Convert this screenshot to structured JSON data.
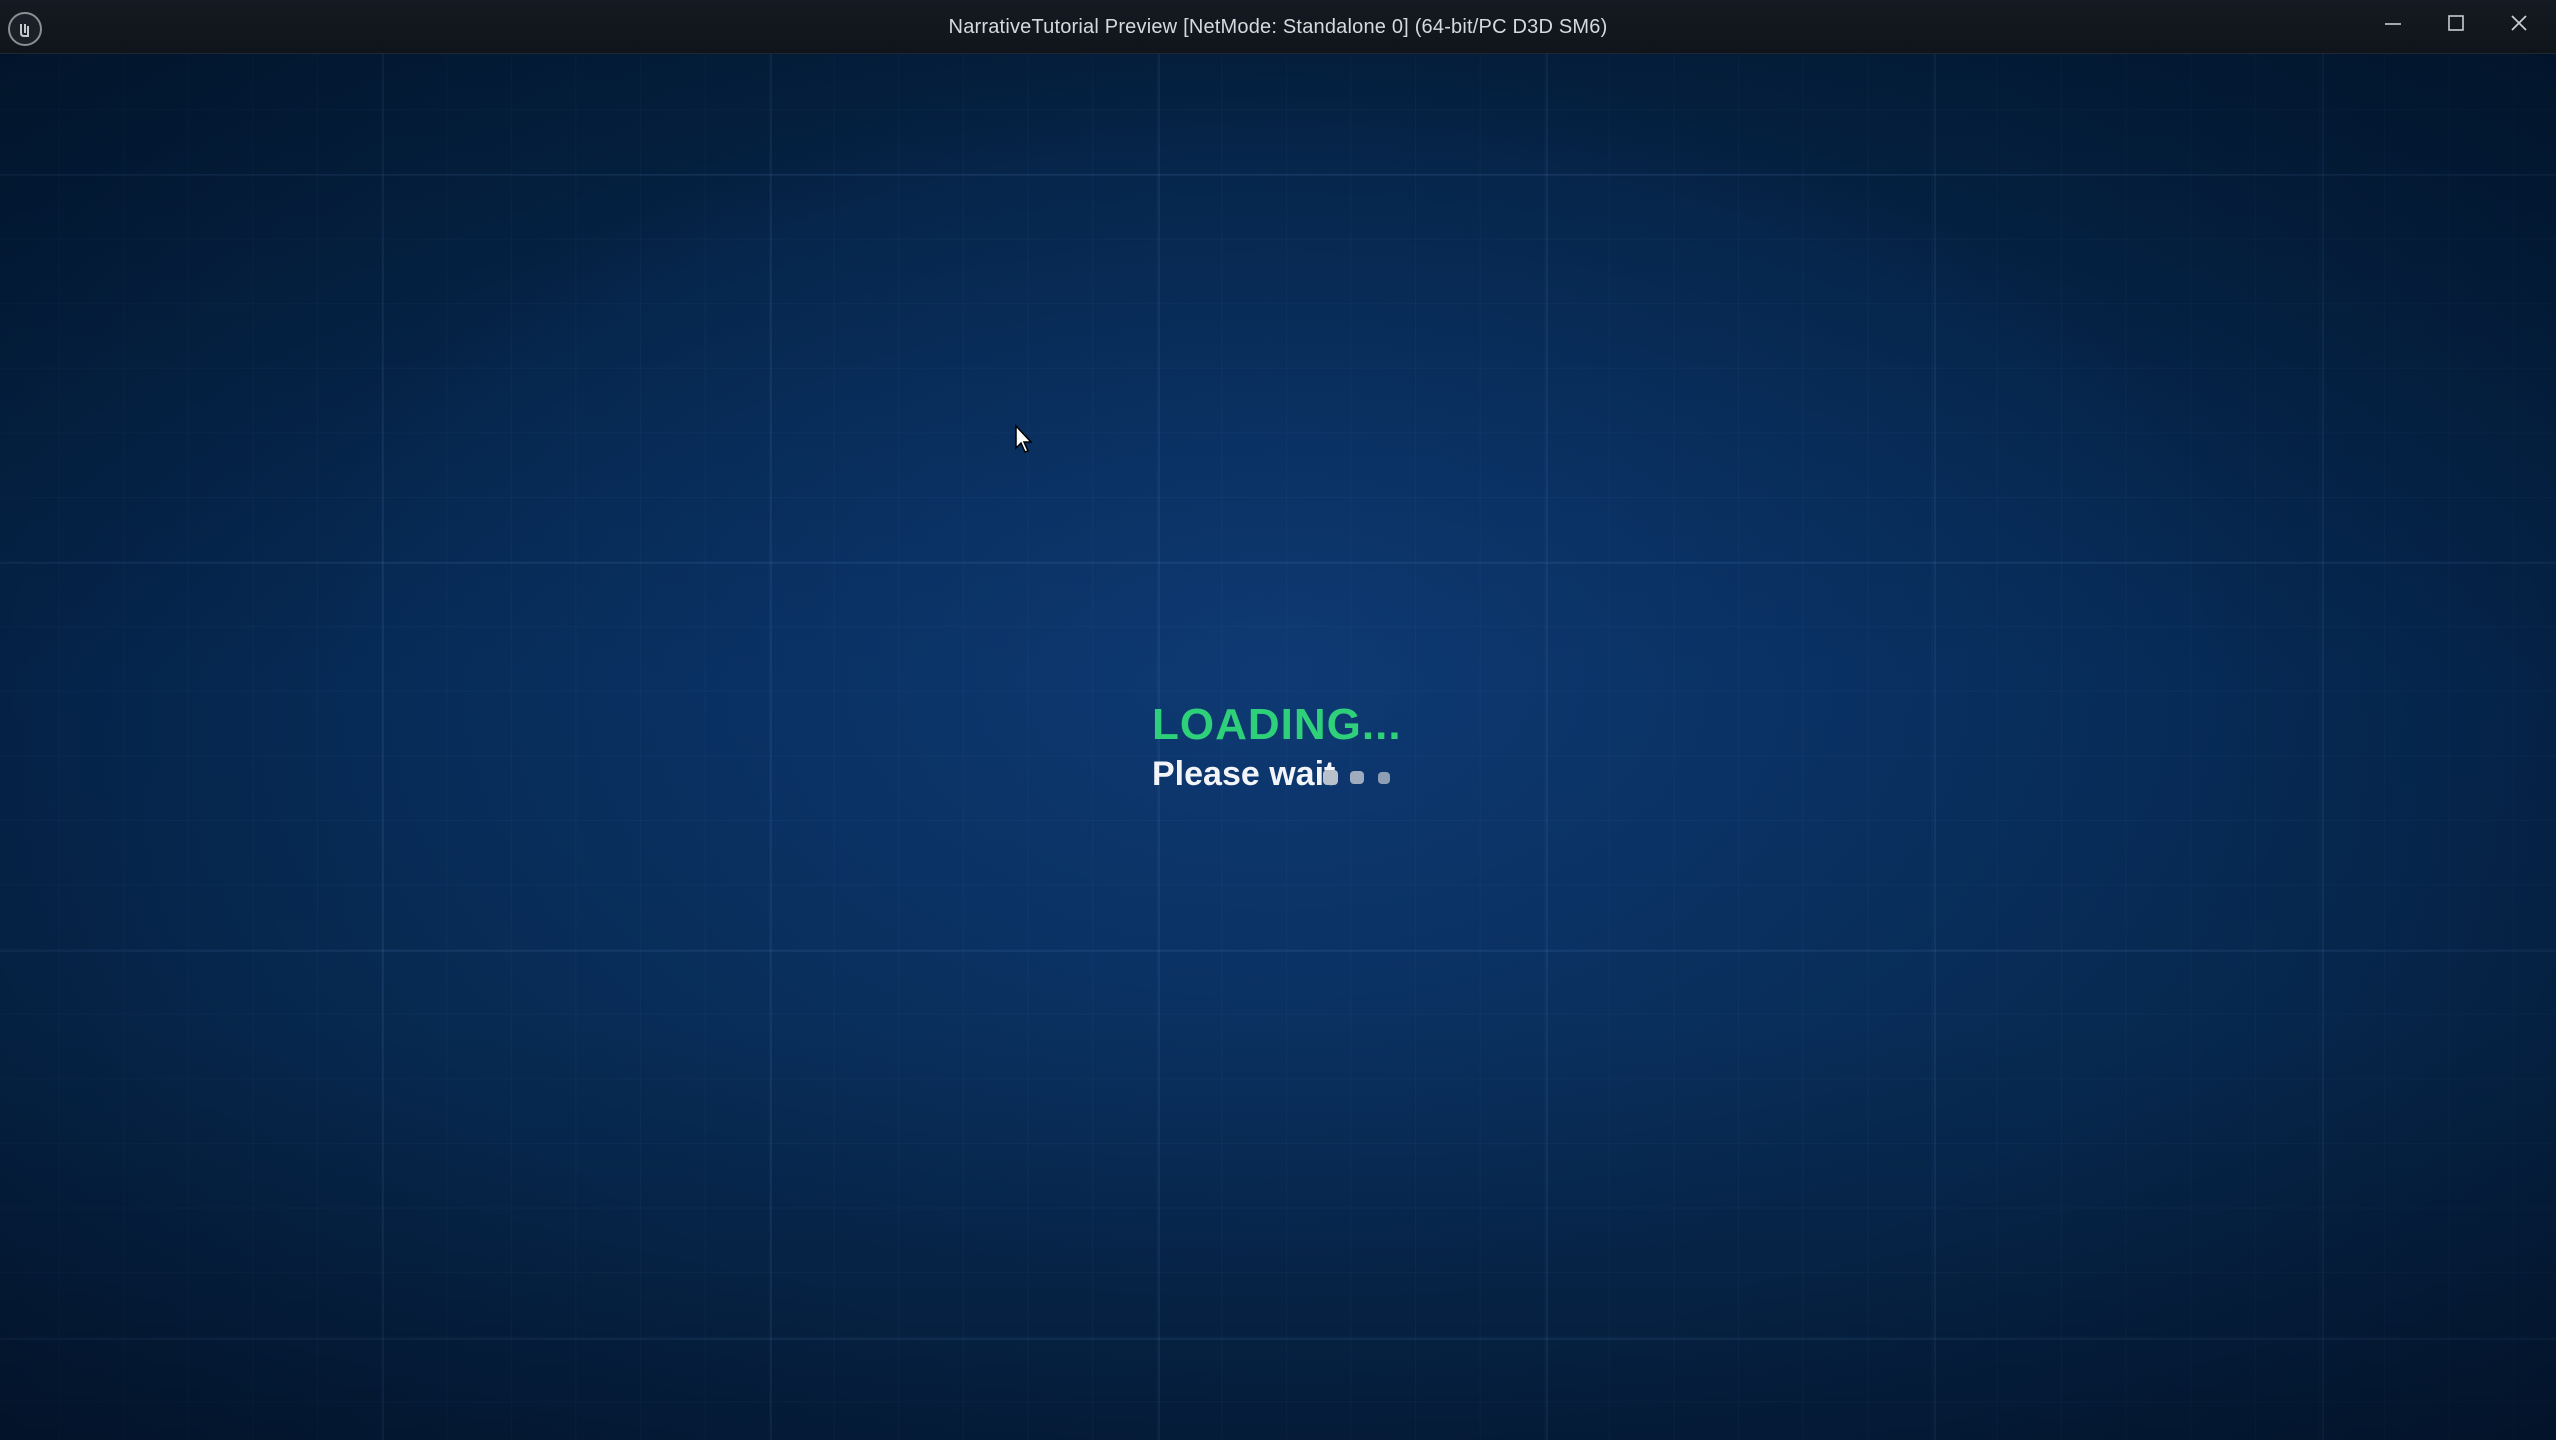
{
  "window": {
    "title": "NarrativeTutorial Preview [NetMode: Standalone 0]  (64-bit/PC D3D SM6)",
    "app_icon": "unreal-engine-logo",
    "controls": {
      "minimize_icon": "minimize-icon",
      "maximize_icon": "maximize-icon",
      "close_icon": "close-icon"
    }
  },
  "loading": {
    "title": "LOADING...",
    "subtitle": "Please wait",
    "indicator_icon": "loading-dots-icon"
  },
  "colors": {
    "loading_title": "#2fd07a",
    "background": "#062a55"
  }
}
